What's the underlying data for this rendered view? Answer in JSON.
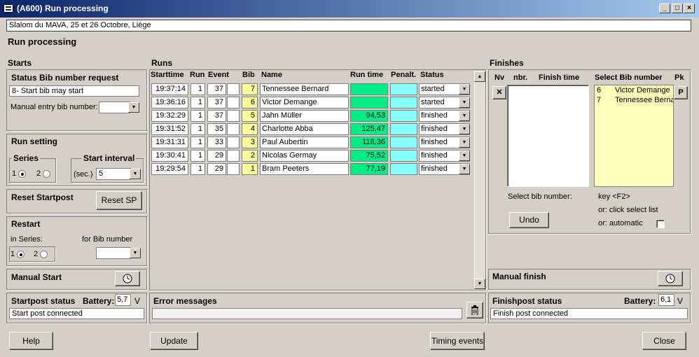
{
  "window": {
    "title": "(A600) Run processing",
    "event_name": "Slalom du MAVA, 25 et 26 Octobre, Liège",
    "heading": "Run processing"
  },
  "starts": {
    "title": "Starts",
    "status_bib": {
      "title": "Status Bib number request",
      "status": "8- Start bib may start",
      "manual_label": "Manual entry bib number:",
      "manual_value": ""
    },
    "run_setting": {
      "title": "Run setting",
      "series_label": "Series",
      "series_opt1": "1",
      "series_opt2": "2",
      "interval_label": "Start interval",
      "sec_label": "(sec.)",
      "interval_value": "5"
    },
    "reset": {
      "title": "Reset Startpost",
      "button": "Reset SP"
    },
    "restart": {
      "title": "Restart",
      "in_series": "in Series:",
      "for_bib": "for Bib number",
      "opt1": "1",
      "opt2": "2",
      "bib_value": ""
    },
    "manual_start": {
      "title": "Manual Start"
    },
    "startpost": {
      "title": "Startpost status",
      "battery_label": "Battery:",
      "battery_value": "5,7",
      "unit": "V",
      "status": "Start post connected"
    }
  },
  "runs": {
    "title": "Runs",
    "columns": {
      "starttime": "Starttime",
      "run": "Run",
      "event": "Event",
      "bib": "Bib",
      "name": "Name",
      "runtime": "Run time",
      "penalt": "Penalt.",
      "status": "Status"
    },
    "rows": [
      {
        "starttime": "19:37:14",
        "run": "1",
        "event": "37",
        "bib": "7",
        "name": "Tennessee Bernard",
        "runtime": "",
        "penalt": "",
        "status": "started"
      },
      {
        "starttime": "19:36:16",
        "run": "1",
        "event": "37",
        "bib": "6",
        "name": "Victor Demange",
        "runtime": "",
        "penalt": "",
        "status": "started"
      },
      {
        "starttime": "19:32:29",
        "run": "1",
        "event": "37",
        "bib": "5",
        "name": "Jahn Müller",
        "runtime": "94,53",
        "penalt": "",
        "status": "finished"
      },
      {
        "starttime": "19:31:52",
        "run": "1",
        "event": "35",
        "bib": "4",
        "name": "Charlotte Abba",
        "runtime": "125,47",
        "penalt": "",
        "status": "finished"
      },
      {
        "starttime": "19:31:31",
        "run": "1",
        "event": "33",
        "bib": "3",
        "name": "Paul Aubertin",
        "runtime": "118,36",
        "penalt": "",
        "status": "finished"
      },
      {
        "starttime": "19:30:41",
        "run": "1",
        "event": "29",
        "bib": "2",
        "name": "Nicolas Germay",
        "runtime": "75,52",
        "penalt": "",
        "status": "finished"
      },
      {
        "starttime": "19:29:54",
        "run": "1",
        "event": "29",
        "bib": "1",
        "name": "Bram Peeters",
        "runtime": "77,19",
        "penalt": "",
        "status": "finished"
      }
    ],
    "errors_title": "Error messages",
    "errors_value": ""
  },
  "finishes": {
    "title": "Finishes",
    "columns": {
      "nv": "Nv",
      "nbr": "nbr.",
      "finish_time": "Finish time",
      "select_bib": "Select Bib number",
      "pk": "Pk"
    },
    "select_list": [
      {
        "bib": "6",
        "name": "Victor Demange"
      },
      {
        "bib": "7",
        "name": "Tennessee Bernard"
      }
    ],
    "select_label": "Select bib number:",
    "key_label": "key <F2>",
    "or_click": "or: click select list",
    "or_auto": "or: automatic",
    "undo": "Undo",
    "x_btn": "✕",
    "p_btn": "P",
    "manual_finish": {
      "title": "Manual finish"
    },
    "finishpost": {
      "title": "Finishpost status",
      "battery_label": "Battery:",
      "battery_value": "6,1",
      "unit": "V",
      "status": "Finish post connected"
    }
  },
  "footer": {
    "help": "Help",
    "update": "Update",
    "timing": "Timing events",
    "close": "Close"
  },
  "colors": {
    "bib_bg": "#ffff99",
    "runtime_bg": "#00ee88",
    "penalty_bg": "#88ffff",
    "select_bg": "#ffffbb"
  }
}
